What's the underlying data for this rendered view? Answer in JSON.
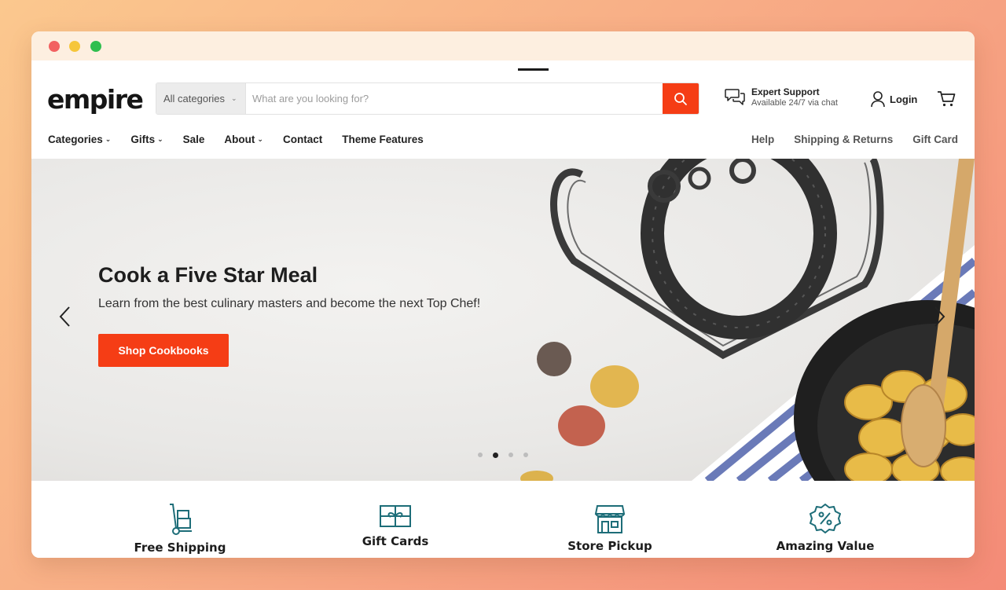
{
  "colors": {
    "accent": "#f53d15",
    "teal": "#1d6d78",
    "text": "#1e1e1e"
  },
  "logo": {
    "text": "empire"
  },
  "search": {
    "category": "All categories",
    "placeholder": "What are you looking for?",
    "button_icon": "search-icon"
  },
  "support": {
    "title": "Expert Support",
    "subtitle": "Available 24/7 via chat",
    "icon": "chat-bubbles-icon"
  },
  "login": {
    "label": "Login",
    "icon": "user-icon"
  },
  "cart": {
    "icon": "cart-icon"
  },
  "nav": {
    "left": [
      {
        "label": "Categories",
        "dropdown": true
      },
      {
        "label": "Gifts",
        "dropdown": true
      },
      {
        "label": "Sale",
        "dropdown": false
      },
      {
        "label": "About",
        "dropdown": true
      },
      {
        "label": "Contact",
        "dropdown": false
      },
      {
        "label": "Theme Features",
        "dropdown": false
      }
    ],
    "right": [
      "Help",
      "Shipping & Returns",
      "Gift Card"
    ]
  },
  "hero": {
    "title": "Cook a Five Star Meal",
    "subtitle": "Learn from the best culinary masters and become the next Top Chef!",
    "button": "Shop Cookbooks",
    "slides": 4,
    "active_slide": 2
  },
  "features": [
    {
      "label": "Free Shipping",
      "icon": "hand-truck-icon"
    },
    {
      "label": "Gift Cards",
      "icon": "gift-card-icon"
    },
    {
      "label": "Store Pickup",
      "icon": "storefront-icon"
    },
    {
      "label": "Amazing Value",
      "icon": "percent-badge-icon"
    }
  ]
}
